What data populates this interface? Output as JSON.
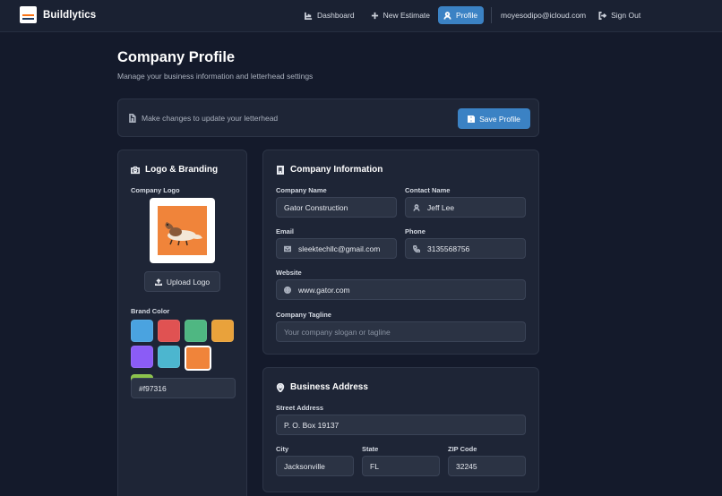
{
  "app": {
    "name": "Buildlytics"
  },
  "nav": {
    "dashboard": "Dashboard",
    "new_estimate": "New Estimate",
    "profile": "Profile",
    "user_email": "moyesodipo@icloud.com",
    "sign_out": "Sign Out"
  },
  "page": {
    "title": "Company Profile",
    "subtitle": "Manage your business information and letterhead settings"
  },
  "banner": {
    "message": "Make changes to update your letterhead",
    "save_label": "Save Profile"
  },
  "branding": {
    "title": "Logo & Branding",
    "logo_label": "Company Logo",
    "upload_label": "Upload Logo",
    "color_label": "Brand Color",
    "selected_color": "#f97316",
    "colors": [
      "#4aa3e0",
      "#e05252",
      "#4fb782",
      "#e9a23b",
      "#8b5cf6",
      "#4cb6cf",
      "#f0843a",
      "#8bc34a"
    ]
  },
  "company": {
    "title": "Company Information",
    "name_label": "Company Name",
    "name_value": "Gator Construction",
    "contact_label": "Contact Name",
    "contact_value": "Jeff Lee",
    "email_label": "Email",
    "email_value": "sleektechllc@gmail.com",
    "phone_label": "Phone",
    "phone_value": "3135568756",
    "website_label": "Website",
    "website_value": "www.gator.com",
    "tagline_label": "Company Tagline",
    "tagline_placeholder": "Your company slogan or tagline"
  },
  "address": {
    "title": "Business Address",
    "street_label": "Street Address",
    "street_value": "P. O. Box 19137",
    "city_label": "City",
    "city_value": "Jacksonville",
    "state_label": "State",
    "state_value": "FL",
    "zip_label": "ZIP Code",
    "zip_value": "32245"
  }
}
